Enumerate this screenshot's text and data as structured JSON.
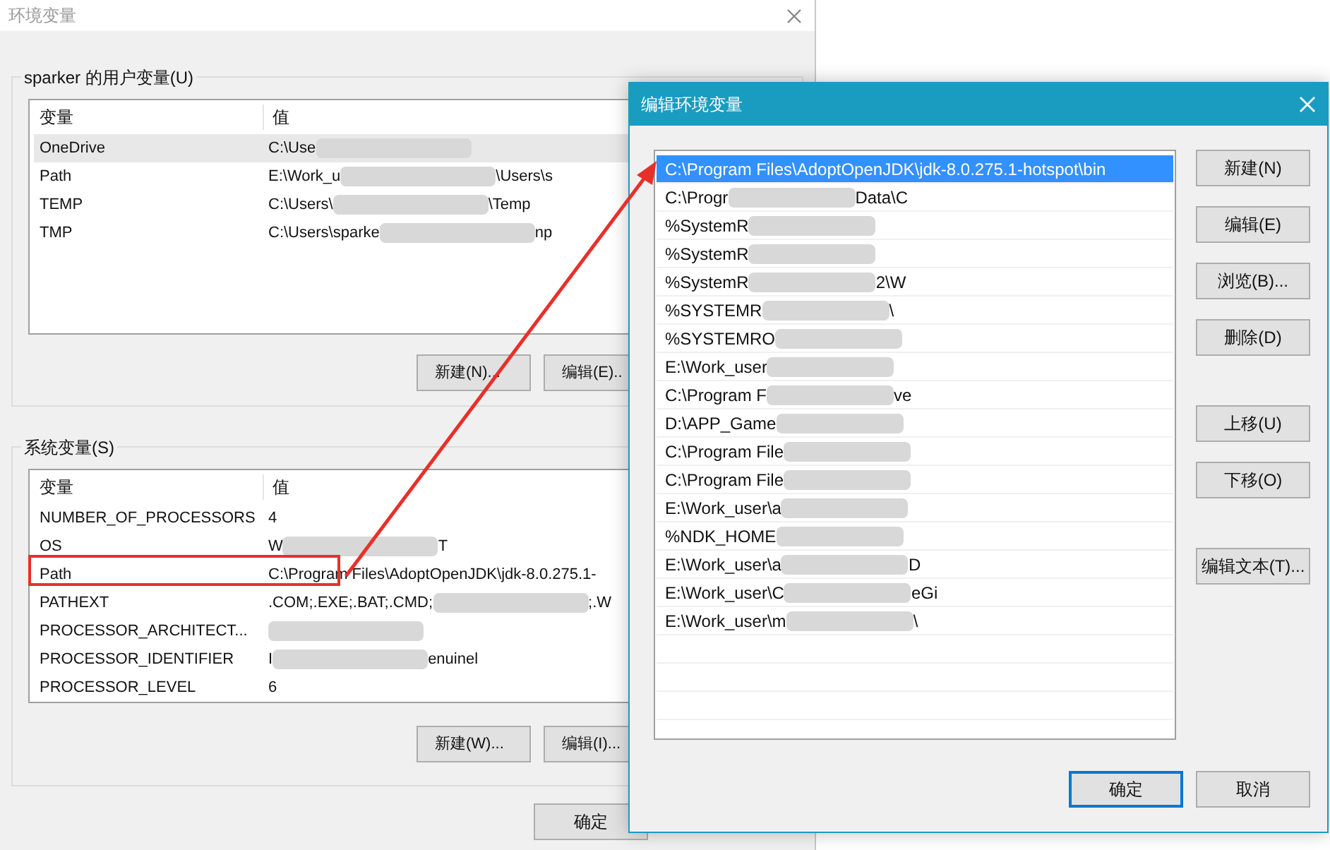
{
  "main_window": {
    "title": "环境变量",
    "user_section": {
      "title": "sparker 的用户变量(U)",
      "columns": [
        "变量",
        "值"
      ],
      "rows": [
        {
          "name": "OneDrive",
          "value": "C:\\Use",
          "selected": true
        },
        {
          "name": "Path",
          "value": "E:\\Work_u",
          "tail": "\\Users\\s",
          "selected": false
        },
        {
          "name": "TEMP",
          "value": "C:\\Users\\",
          "tail": "\\Temp",
          "selected": false
        },
        {
          "name": "TMP",
          "value": "C:\\Users\\sparke",
          "tail": "np",
          "selected": false
        }
      ],
      "buttons": [
        "新建(N)...",
        "编辑(E).."
      ]
    },
    "system_section": {
      "title": "系统变量(S)",
      "columns": [
        "变量",
        "值"
      ],
      "rows": [
        {
          "name": "NUMBER_OF_PROCESSORS",
          "value": "4",
          "blurred": false,
          "selected": false
        },
        {
          "name": "OS",
          "value": "W",
          "blurred": true,
          "tail": "T",
          "selected": false
        },
        {
          "name": "Path",
          "value": "C:\\Program Files\\AdoptOpenJDK\\jdk-8.0.275.1-",
          "blurred": false,
          "selected": false
        },
        {
          "name": "PATHEXT",
          "value": ".COM;.EXE;.BAT;.CMD;",
          "blurred": true,
          "tail": ";.W",
          "selected": false
        },
        {
          "name": "PROCESSOR_ARCHITECT...",
          "blurred": true,
          "selected": false
        },
        {
          "name": "PROCESSOR_IDENTIFIER",
          "value": "I",
          "blurred": true,
          "tail": "enuinel",
          "selected": false
        },
        {
          "name": "PROCESSOR_LEVEL",
          "value": "6",
          "blurred": false,
          "selected": false
        }
      ],
      "buttons": [
        "新建(W)...",
        "编辑(I)..."
      ]
    },
    "footer_buttons": [
      "确定"
    ]
  },
  "edit_dialog": {
    "title": "编辑环境变量",
    "entries": [
      {
        "text": "C:\\Program Files\\AdoptOpenJDK\\jdk-8.0.275.1-hotspot\\bin",
        "blurred": false,
        "selected": true
      },
      {
        "text": "C:\\Progr",
        "blurred": true,
        "tail": "Data\\C",
        "selected": false
      },
      {
        "text": "%SystemR",
        "blurred": true,
        "selected": false
      },
      {
        "text": "%SystemR",
        "blurred": true,
        "selected": false
      },
      {
        "text": "%SystemR",
        "blurred": true,
        "tail": "2\\W",
        "selected": false
      },
      {
        "text": "%SYSTEMR",
        "blurred": true,
        "tail": "\\",
        "selected": false
      },
      {
        "text": "%SYSTEMRO",
        "blurred": true,
        "selected": false
      },
      {
        "text": "E:\\Work_user",
        "blurred": true,
        "selected": false
      },
      {
        "text": "C:\\Program F",
        "blurred": true,
        "tail": "ve",
        "selected": false
      },
      {
        "text": "D:\\APP_Game",
        "blurred": true,
        "selected": false
      },
      {
        "text": "C:\\Program File",
        "blurred": true,
        "selected": false
      },
      {
        "text": "C:\\Program File",
        "blurred": true,
        "selected": false
      },
      {
        "text": "E:\\Work_user\\a",
        "blurred": true,
        "selected": false
      },
      {
        "text": "%NDK_HOME",
        "blurred": true,
        "selected": false
      },
      {
        "text": "E:\\Work_user\\a",
        "blurred": true,
        "tail": "D",
        "selected": false
      },
      {
        "text": "E:\\Work_user\\C",
        "blurred": true,
        "tail": "eGi",
        "selected": false
      },
      {
        "text": "E:\\Work_user\\m",
        "blurred": true,
        "tail": "\\",
        "selected": false
      }
    ],
    "side_button_groups": [
      [
        "新建(N)",
        "编辑(E)",
        "浏览(B)...",
        "删除(D)"
      ],
      [
        "上移(U)",
        "下移(O)"
      ],
      [
        "编辑文本(T)..."
      ]
    ],
    "footer_buttons": [
      {
        "label": "确定",
        "default": true
      },
      {
        "label": "取消",
        "default": false
      }
    ]
  }
}
